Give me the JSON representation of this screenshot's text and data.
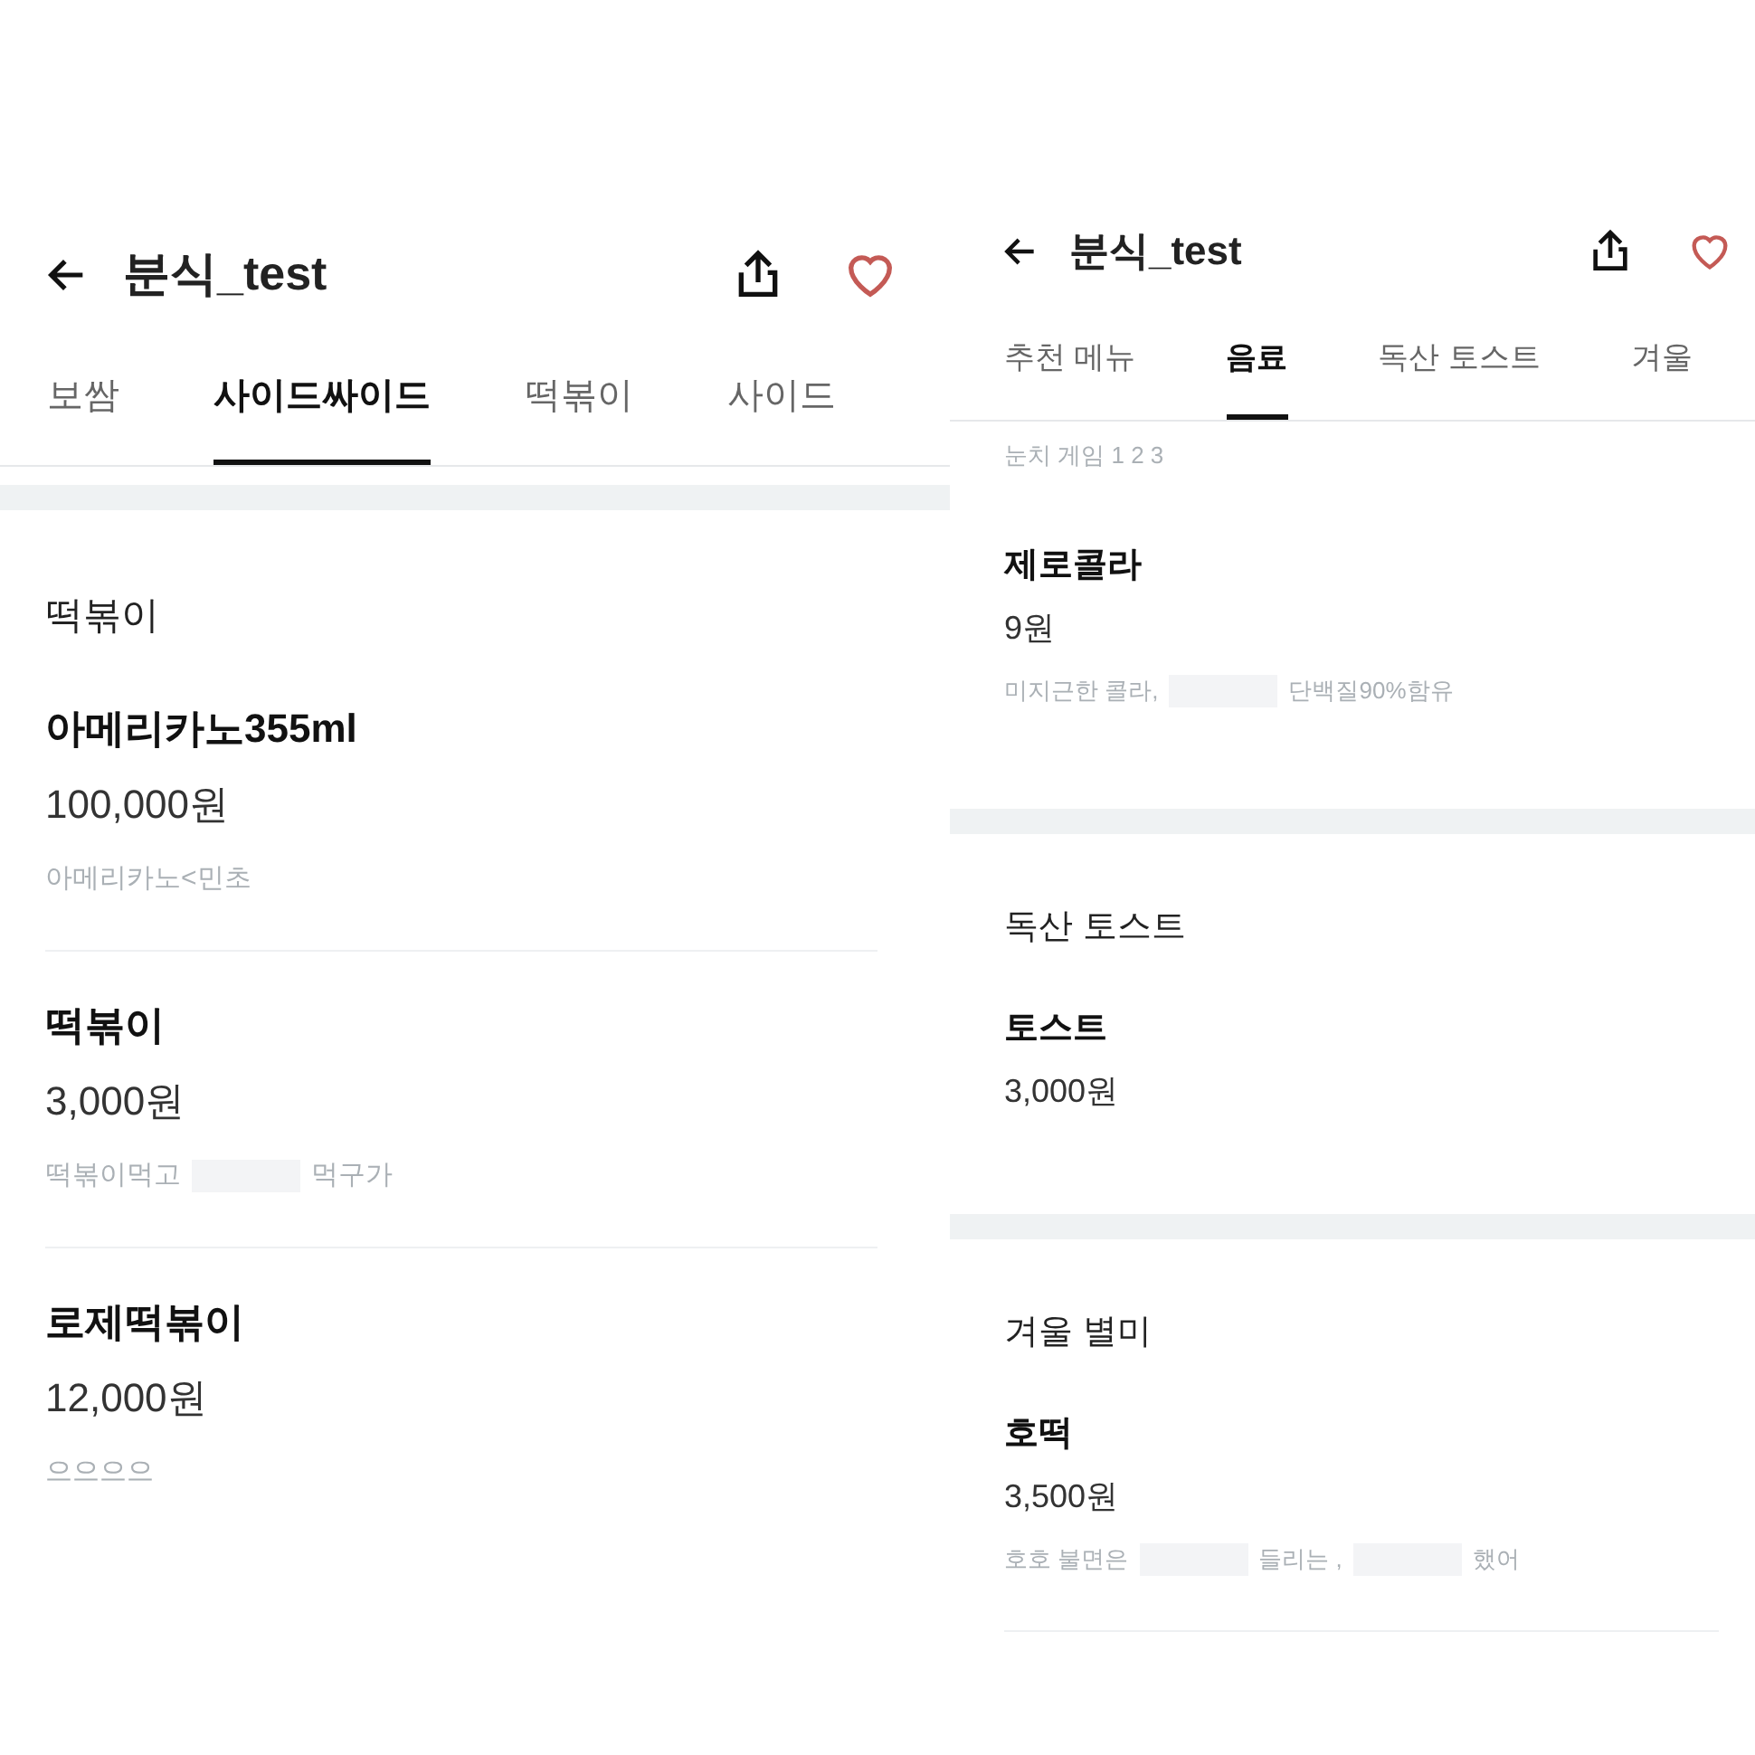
{
  "panels": [
    {
      "title": "분식_test",
      "liked": true,
      "tabs": [
        {
          "label": "보쌈",
          "selected": false
        },
        {
          "label": "사이드싸이드",
          "selected": true
        },
        {
          "label": "떡볶이",
          "selected": false
        },
        {
          "label": "사이드",
          "selected": false
        }
      ],
      "sections": [
        {
          "title": "떡볶이",
          "items": [
            {
              "name": "아메리카노355ml",
              "price": "100,000원",
              "description": [
                {
                  "kind": "text",
                  "text": "아메리카노<민초"
                }
              ]
            },
            {
              "name": "떡볶이",
              "price": "3,000원",
              "description": [
                {
                  "kind": "text",
                  "text": "떡볶이먹고"
                },
                {
                  "kind": "redacted"
                },
                {
                  "kind": "text",
                  "text": "먹구가"
                }
              ]
            },
            {
              "name": "로제떡볶이",
              "price": "12,000원",
              "description": [
                {
                  "kind": "text",
                  "text": "으으으으"
                }
              ]
            }
          ]
        }
      ]
    },
    {
      "title": "분식_test",
      "liked": true,
      "tabs": [
        {
          "label": "추천 메뉴",
          "selected": false
        },
        {
          "label": "음료",
          "selected": true
        },
        {
          "label": "독산 토스트",
          "selected": false
        },
        {
          "label": "겨울",
          "selected": false
        }
      ],
      "cut_description": "눈치 게임 1 2 3",
      "sections": [
        {
          "items": [
            {
              "name": "제로콜라",
              "price": "9원",
              "description": [
                {
                  "kind": "text",
                  "text": "미지근한 콜라,"
                },
                {
                  "kind": "redacted"
                },
                {
                  "kind": "text",
                  "text": "단백질90%함유"
                }
              ]
            }
          ]
        },
        {
          "title": "독산 토스트",
          "items": [
            {
              "name": "토스트",
              "price": "3,000원"
            }
          ]
        },
        {
          "title": "겨울 별미",
          "items": [
            {
              "name": "호떡",
              "price": "3,500원",
              "description": [
                {
                  "kind": "text",
                  "text": "호호 불면은"
                },
                {
                  "kind": "redacted"
                },
                {
                  "kind": "text",
                  "text": "들리는 ,"
                },
                {
                  "kind": "redacted"
                },
                {
                  "kind": "text",
                  "text": "했어"
                }
              ]
            }
          ]
        }
      ]
    }
  ]
}
